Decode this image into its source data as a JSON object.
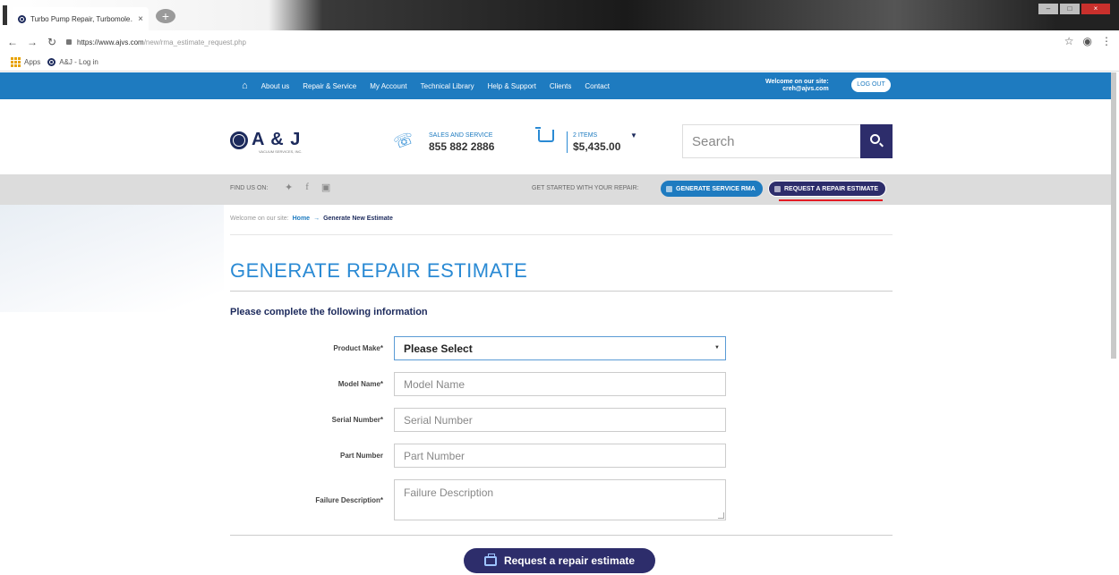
{
  "browser": {
    "tab_title": "Turbo Pump Repair, Turbomole…",
    "tab_close": "×",
    "new_tab": "+",
    "url_domain": "https://www.ajvs.com",
    "url_path": "/new/rma_estimate_request.php",
    "bookmarks": [
      {
        "label": "Apps"
      },
      {
        "label": "A&J - Log in"
      }
    ]
  },
  "topnav": {
    "items": [
      "About us",
      "Repair & Service",
      "My Account",
      "Technical Library",
      "Help & Support",
      "Clients",
      "Contact"
    ],
    "welcome_line1": "Welcome on our site:",
    "welcome_line2": "creh@ajvs.com",
    "logout": "LOG OUT"
  },
  "header": {
    "logo_text": "A & J",
    "logo_sub": "VACUUM SERVICES, INC.",
    "sales_label": "SALES AND SERVICE",
    "sales_phone": "855 882 2886",
    "cart_items": "2 ITEMS",
    "cart_total": "$5,435.00",
    "search_placeholder": "Search"
  },
  "social_bar": {
    "find_us": "FIND US ON:",
    "cta_label": "GET STARTED WITH YOUR REPAIR:",
    "btn_rma": "GENERATE SERVICE RMA",
    "btn_estimate": "REQUEST A REPAIR ESTIMATE"
  },
  "breadcrumb": {
    "prefix": "Welcome on our site:",
    "home": "Home",
    "sep": "→",
    "current": "Generate New Estimate"
  },
  "main": {
    "title": "GENERATE REPAIR ESTIMATE",
    "section_heading": "Please complete the following information",
    "form": {
      "product_make_label": "Product Make*",
      "product_make_value": "Please Select",
      "model_name_label": "Model Name*",
      "model_name_placeholder": "Model Name",
      "serial_number_label": "Serial Number*",
      "serial_number_placeholder": "Serial Number",
      "part_number_label": "Part Number",
      "part_number_placeholder": "Part Number",
      "failure_label": "Failure Description*",
      "failure_placeholder": "Failure Description",
      "submit": "Request a repair estimate"
    }
  },
  "colors": {
    "brand_blue": "#1e7bc0",
    "navy": "#2d2d6b",
    "accent_red": "#e31b23"
  }
}
